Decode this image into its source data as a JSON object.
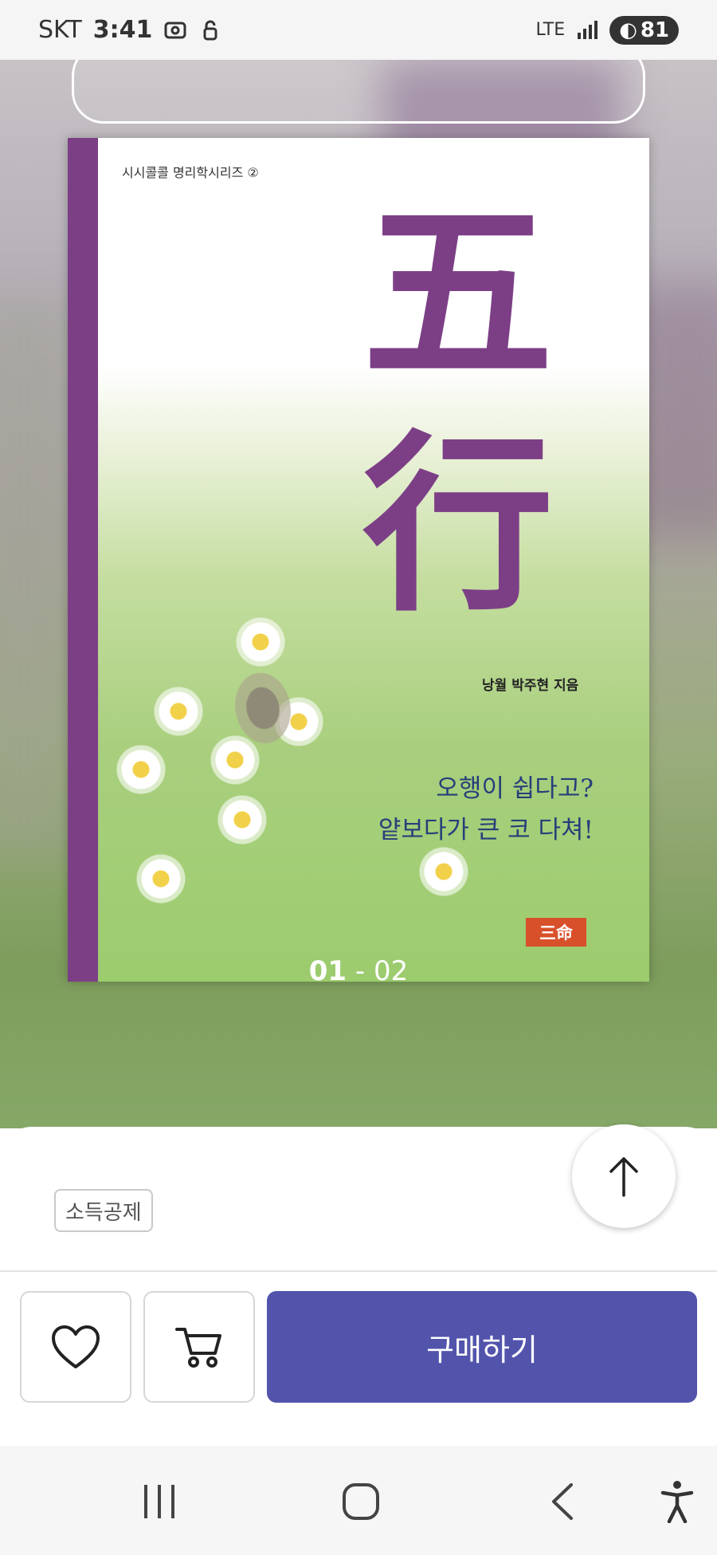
{
  "status_bar": {
    "carrier": "SKT",
    "time": "3:41",
    "network": "LTE",
    "battery": "81"
  },
  "book": {
    "series": "시시콜콜 명리학시리즈 ②",
    "title": "五行",
    "author": "낭월 박주현 지음",
    "tagline_line1": "오행이 쉽다고?",
    "tagline_line2": "얕보다가 큰 코 다쳐!",
    "publisher": "三命",
    "spine_color": "#7c3f86"
  },
  "pager": {
    "current": "01",
    "separator": " - ",
    "total": "02"
  },
  "sheet": {
    "tag": "소득공제",
    "buy_label": "구매하기",
    "buy_color": "#5254ac"
  },
  "icons": {
    "scroll_top": "arrow-up-icon",
    "wishlist": "heart-icon",
    "cart": "cart-icon",
    "recent_apps": "recent-apps-icon",
    "home": "home-icon",
    "back": "back-icon",
    "accessibility": "accessibility-icon"
  }
}
